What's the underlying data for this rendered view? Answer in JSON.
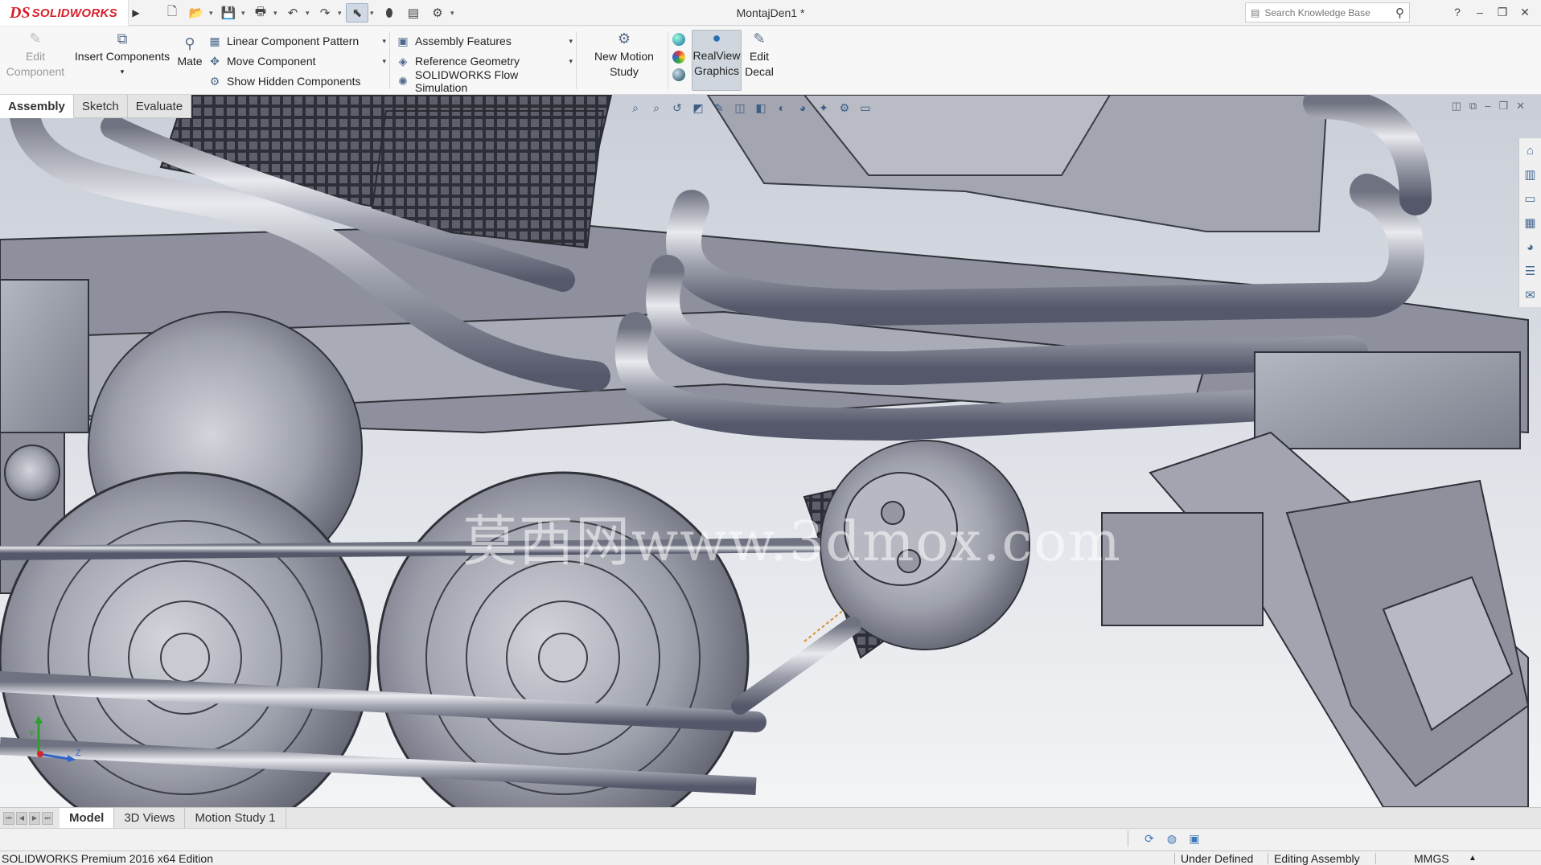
{
  "app": {
    "logo_mark": "DS",
    "logo_text": "SOLIDWORKS",
    "document_title": "MontajDen1 *"
  },
  "quick_access": [
    {
      "name": "new-file-icon",
      "glyph": "🗋"
    },
    {
      "name": "open-file-icon",
      "glyph": "📂"
    },
    {
      "name": "save-icon",
      "glyph": "💾"
    },
    {
      "name": "print-icon",
      "glyph": "🖶"
    },
    {
      "name": "undo-icon",
      "glyph": "↶"
    },
    {
      "name": "redo-icon",
      "glyph": "↷"
    },
    {
      "name": "select-pointer-icon",
      "glyph": "⬉"
    },
    {
      "name": "traffic-light-icon",
      "glyph": "⬮"
    },
    {
      "name": "file-properties-icon",
      "glyph": "▤"
    },
    {
      "name": "options-gear-icon",
      "glyph": "⚙"
    }
  ],
  "search": {
    "placeholder": "Search Knowledge Base"
  },
  "window_controls": {
    "help": "?",
    "minimize": "–",
    "maximize": "❐",
    "close": "✕"
  },
  "ribbon": {
    "edit_component": [
      "Edit",
      "Component"
    ],
    "insert_components": "Insert Components",
    "mate": "Mate",
    "linear_pattern": "Linear Component Pattern",
    "move_component": "Move Component",
    "show_hidden": "Show Hidden Components",
    "assembly_features": "Assembly Features",
    "reference_geometry": "Reference Geometry",
    "flow_simulation": "SOLIDWORKS Flow Simulation",
    "new_motion_study": [
      "New Motion",
      "Study"
    ],
    "realview": [
      "RealView",
      "Graphics"
    ],
    "edit_decal": [
      "Edit",
      "Decal"
    ]
  },
  "command_tabs": [
    "Assembly",
    "Sketch",
    "Evaluate"
  ],
  "watermark": "莫西网www.3dmox.com",
  "triad": {
    "y": "Y",
    "z": "Z"
  },
  "bottom_tabs": [
    "Model",
    "3D Views",
    "Motion Study 1"
  ],
  "status": {
    "edition": "SOLIDWORKS Premium 2016 x64 Edition",
    "definition": "Under Defined",
    "mode": "Editing Assembly",
    "units": "MMGS"
  },
  "colors": {
    "brand": "#d6202b",
    "model_metal": "#9a9da8",
    "viewport_bg": "#dde2e8"
  }
}
